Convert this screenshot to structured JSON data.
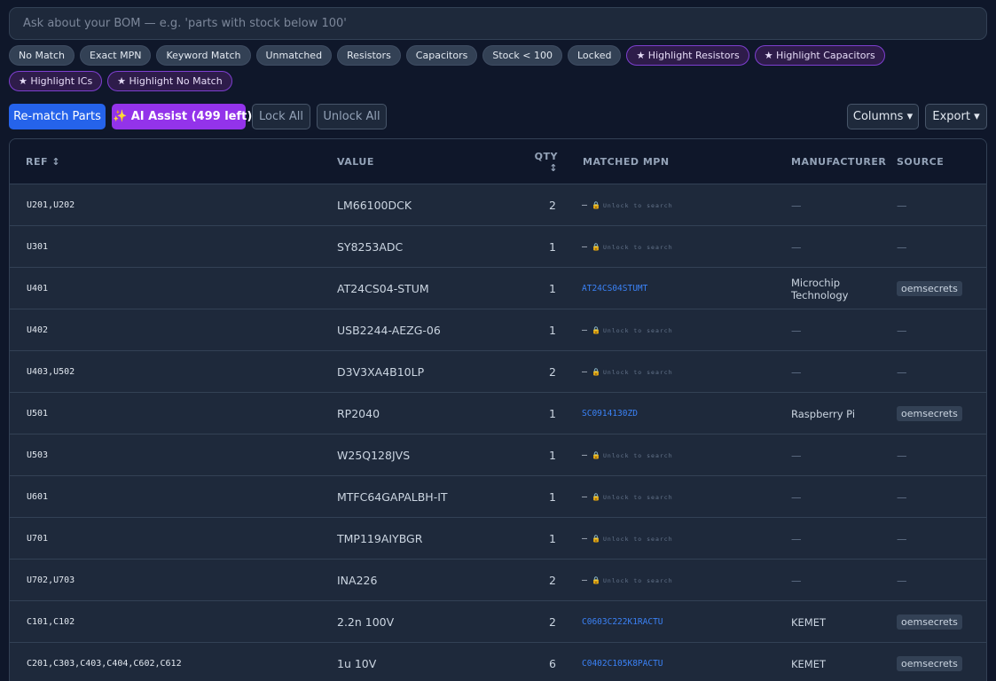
{
  "search": {
    "placeholder": "Ask about your BOM — e.g. 'parts with stock below 100'"
  },
  "filter_chips": [
    {
      "label": "No Match",
      "highlight": false
    },
    {
      "label": "Exact MPN",
      "highlight": false
    },
    {
      "label": "Keyword Match",
      "highlight": false
    },
    {
      "label": "Unmatched",
      "highlight": false
    },
    {
      "label": "Resistors",
      "highlight": false
    },
    {
      "label": "Capacitors",
      "highlight": false
    },
    {
      "label": "Stock < 100",
      "highlight": false
    },
    {
      "label": "Locked",
      "highlight": false
    },
    {
      "label": "★ Highlight Resistors",
      "highlight": true
    },
    {
      "label": "★ Highlight Capacitors",
      "highlight": true
    },
    {
      "label": "★ Highlight ICs",
      "highlight": true
    },
    {
      "label": "★ Highlight No Match",
      "highlight": true
    }
  ],
  "toolbar": {
    "rematch_label": "Re-match Parts",
    "ai_assist_label": "✨ AI Assist (499 left)",
    "lock_all_label": "Lock All",
    "unlock_all_label": "Unlock All",
    "columns_label": "Columns ▾",
    "export_label": "Export ▾"
  },
  "table": {
    "headers": {
      "ref": "REF ↕",
      "value": "VALUE",
      "qty": "QTY",
      "qty_sort": "↕",
      "mpn": "MATCHED MPN",
      "manufacturer": "MANUFACTURER",
      "source": "SOURCE"
    },
    "lock_dash": "—",
    "lock_icon": "🔒",
    "lock_text": "Unlock to search",
    "empty_dash": "—",
    "rows": [
      {
        "ref": "U201,U202",
        "value": "LM66100DCK",
        "qty": "2",
        "mpn": "",
        "manufacturer": "—",
        "source": "—"
      },
      {
        "ref": "U301",
        "value": "SY8253ADC",
        "qty": "1",
        "mpn": "",
        "manufacturer": "—",
        "source": "—"
      },
      {
        "ref": "U401",
        "value": "AT24CS04-STUM",
        "qty": "1",
        "mpn": "AT24CS04STUMT",
        "manufacturer": "Microchip Technology",
        "source": "oemsecrets"
      },
      {
        "ref": "U402",
        "value": "USB2244-AEZG-06",
        "qty": "1",
        "mpn": "",
        "manufacturer": "—",
        "source": "—"
      },
      {
        "ref": "U403,U502",
        "value": "D3V3XA4B10LP",
        "qty": "2",
        "mpn": "",
        "manufacturer": "—",
        "source": "—"
      },
      {
        "ref": "U501",
        "value": "RP2040",
        "qty": "1",
        "mpn": "SC0914130ZD",
        "manufacturer": "Raspberry Pi",
        "source": "oemsecrets"
      },
      {
        "ref": "U503",
        "value": "W25Q128JVS",
        "qty": "1",
        "mpn": "",
        "manufacturer": "—",
        "source": "—"
      },
      {
        "ref": "U601",
        "value": "MTFC64GAPALBH-IT",
        "qty": "1",
        "mpn": "",
        "manufacturer": "—",
        "source": "—"
      },
      {
        "ref": "U701",
        "value": "TMP119AIYBGR",
        "qty": "1",
        "mpn": "",
        "manufacturer": "—",
        "source": "—"
      },
      {
        "ref": "U702,U703",
        "value": "INA226",
        "qty": "2",
        "mpn": "",
        "manufacturer": "—",
        "source": "—"
      },
      {
        "ref": "C101,C102",
        "value": "2.2n 100V",
        "qty": "2",
        "mpn": "C0603C222K1RACTU",
        "manufacturer": "KEMET",
        "source": "oemsecrets"
      },
      {
        "ref": "C201,C303,C403,C404,C602,C612",
        "value": "1u 10V",
        "qty": "6",
        "mpn": "C0402C105K8PACTU",
        "manufacturer": "KEMET",
        "source": "oemsecrets"
      }
    ]
  }
}
